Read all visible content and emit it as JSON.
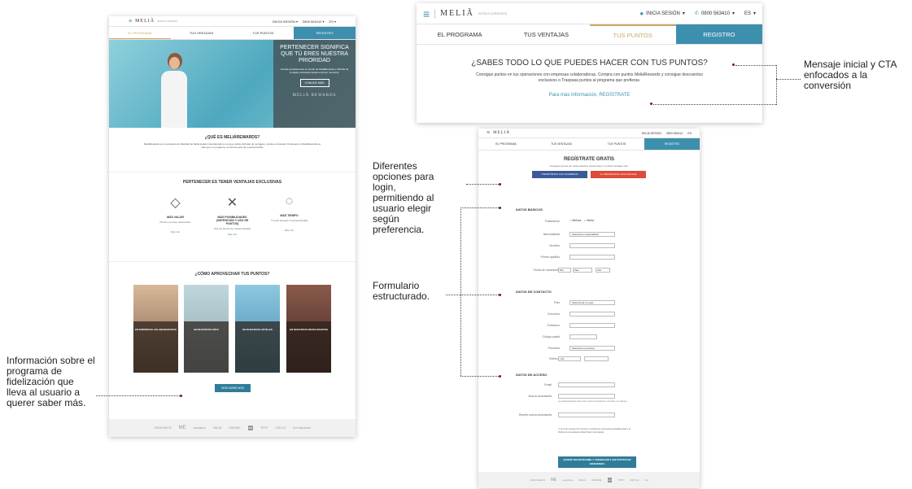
{
  "left_page": {
    "brand": "MELIÃ",
    "brand_sub": "HOTELS & RESORTS",
    "top_links": [
      "INICIA SESIÓN ▾",
      "0800 563410 ▾",
      "ES ▾"
    ],
    "tabs": [
      "EL PROGRAMA",
      "TUS VENTAJAS",
      "TUS PUNTOS",
      "REGISTRO"
    ],
    "hero_title": "PERTENECER SIGNIFICA QUE TÚ ERES NUESTRA PRIORIDAD",
    "hero_text": "Accede gratuitamente al mundo de MeliáRewards y disfruta de ventajas exclusivas desde el primer momento.",
    "hero_button": "CONOCE MÁS",
    "hero_logo": "MELIÃ REWARDS",
    "what_title": "¿QUÉ ES MELIÁREWARDS?",
    "what_text": "MeliáRewards es el programa de fidelidad de Meliá Hotels International con el que podrás disfrutar de ventajas y ofertas exclusivas. Pertenecer a MeliáRewards es más que un programa, es formar parte de nuestra familia.",
    "benefits_title": "PERTENECER ES TENER VENTAJAS EXCLUSIVAS",
    "benefits": [
      {
        "title": "MÁS VALOR",
        "text": "Puntos, promos, descuentos",
        "link": "Más info"
      },
      {
        "title": "MÁS POSIBILIDADES (OBTENCIÓN Y USO DE PUNTOS)",
        "text": "Usa tus puntos de manera flexible",
        "link": "Más info"
      },
      {
        "title": "MÁS TIEMPO",
        "text": "Tú eres siempre nuestra prioridad",
        "link": "Más info"
      }
    ],
    "howto_title": "¿CÓMO APROVECHAR TUS PUNTOS?",
    "cards": [
      "EN EMPRESAS COLABORADORAS",
      "EN NUESTROS SPAS",
      "EN NUESTROS HOTELES",
      "EN NUESTROS RESTAURANTES"
    ],
    "discover_button": "DESCUBRE MÁS",
    "footer_brands": [
      "GRAN MELIÃ",
      "ME",
      "paradisus",
      "MELIÃ",
      "INNSIDE",
      "sol",
      "TRYP",
      "CIRCLE",
      "Sol Wyndham"
    ]
  },
  "top_right": {
    "brand": "MELIÃ",
    "brand_sub": "HOTELS & RESORTS",
    "login": "INICIA SESIÓN",
    "phone": "0800 563410",
    "lang": "ES",
    "tabs": [
      "EL PROGRAMA",
      "TUS VENTAJAS",
      "TUS PUNTOS",
      "REGISTRO"
    ],
    "headline": "¿SABES TODO LO QUE PUEDES HACER CON TUS PUNTOS?",
    "body": "Consigue puntos en tus operaciones con empresas colaboradoras, Compra con puntos MeliáRewards y consigue descuentos exclusivos o Traspasa puntos al programa que prefieras.",
    "cta": "Para más información, REGÍSTRATE"
  },
  "form_page": {
    "brand": "MELIÃ",
    "tabs": [
      "EL PROGRAMA",
      "TUS VENTAJAS",
      "TUS PUNTOS",
      "REGISTRO"
    ],
    "title": "REGÍSTRATE GRATIS",
    "subtitle": "Consigue puntos por cada estancia, descuentos y muchas ventajas más.",
    "facebook": "REGÍSTRATE CON FACEBOOK",
    "google": "REGÍSTRATE CON GOOGLE",
    "sec_basic": "DATOS BÁSICOS",
    "basic_fields": [
      "Tratamiento",
      "Nacionalidad",
      "Nombre",
      "Primer apellido",
      "Fecha de nacimiento"
    ],
    "treatment_options": [
      "Señora",
      "Señor"
    ],
    "nationality_placeholder": "Seleccione nacionalidad",
    "dob": [
      "Día",
      "Mes",
      "Año"
    ],
    "sec_contact": "DATOS DE CONTACTO",
    "contact_fields": [
      "País",
      "Dirección",
      "Población",
      "Código postal",
      "Provincia",
      "Teléfono"
    ],
    "country_placeholder": "Seleccionar un país",
    "province_placeholder": "Seleccione provincia",
    "phone_prefix": "+34",
    "sec_access": "DATOS DE ACCESO",
    "access_fields": [
      "Email",
      "Nueva contraseña",
      "Repetir nueva contraseña"
    ],
    "password_hint": "La contraseña debe tener como mínimo 8 caracteres, una letra y un número.",
    "legal": "Al unirme acepto los Términos y condiciones del programa MeliáRewards y la Política de privacidad de Meliá Hotels International.",
    "submit": "QUIERO REGISTRARME Y CONSEGUIR 1.000 PUNTOS DE BIENVENIDA",
    "footer_brands": [
      "GRAN MELIÃ",
      "ME",
      "paradisus",
      "MELIÃ",
      "INNSIDE",
      "sol",
      "TRYP",
      "CIRCLE",
      "Sol"
    ]
  },
  "annotations": {
    "cta": "Mensaje inicial y CTA enfocados a la conversión",
    "login_options": "Diferentes opciones para login, permitiendo al usuario elegir según preferencia.",
    "form": "Formulario estructurado.",
    "program_info": "Información sobre el programa de fidelización que lleva al usuario a querer saber más."
  },
  "colors": {
    "teal": "#3d8fae",
    "dark_teal": "#2f7d99",
    "gold": "#c9a86a",
    "facebook": "#3b5998",
    "google": "#dd4b39",
    "accent_dot": "#6b1a2a"
  }
}
